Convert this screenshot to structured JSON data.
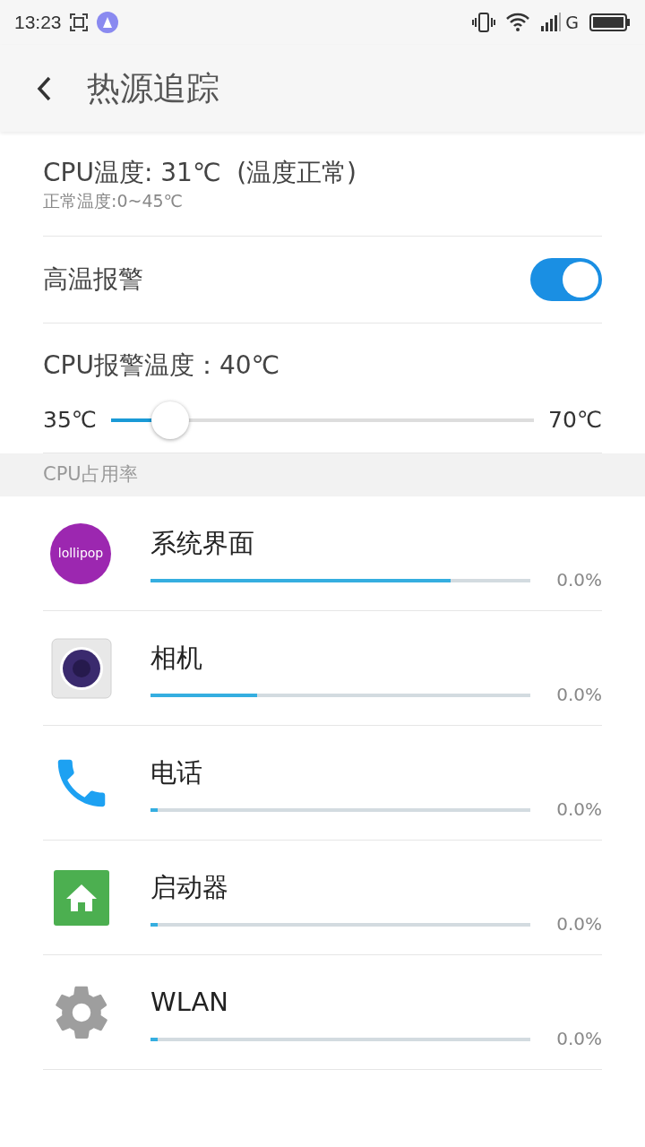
{
  "status_bar": {
    "time": "13:23",
    "network": "G"
  },
  "header": {
    "title": "热源追踪"
  },
  "cpu_temp": {
    "title": "CPU温度: 31℃  (温度正常)",
    "subtitle": "正常温度:0~45℃"
  },
  "alarm": {
    "label": "高温报警",
    "on": true
  },
  "alarm_temp": {
    "label": "CPU报警温度：40℃",
    "min": "35℃",
    "max": "70℃",
    "level": 0.14
  },
  "section": {
    "title": "CPU占用率"
  },
  "apps": [
    {
      "kind": "lollipop",
      "icon_text": "lollipop",
      "name": "系统界面",
      "level": 0.79,
      "value": "0.0%"
    },
    {
      "kind": "camera",
      "name": "相机",
      "level": 0.28,
      "value": "0.0%"
    },
    {
      "kind": "phone",
      "name": "电话",
      "level": 0.02,
      "value": "0.0%"
    },
    {
      "kind": "launcher",
      "name": "启动器",
      "level": 0.02,
      "value": "0.0%"
    },
    {
      "kind": "settings",
      "name": "WLAN",
      "level": 0.02,
      "value": "0.0%"
    }
  ]
}
